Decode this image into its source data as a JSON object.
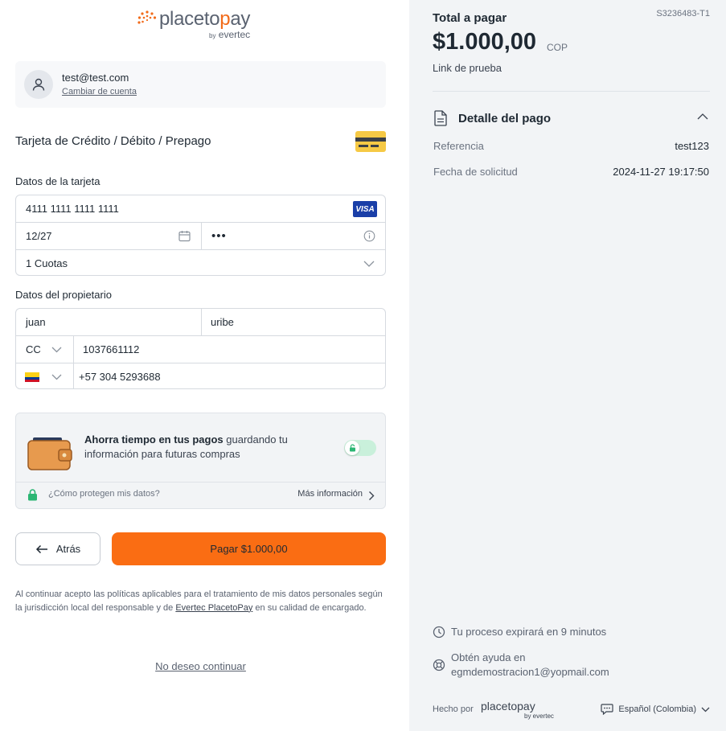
{
  "brand": {
    "name_prefix": "placeto",
    "name_highlight": "p",
    "name_suffix": "ay",
    "by_prefix": "by",
    "by_name": "evertec"
  },
  "account": {
    "email": "test@test.com",
    "change_label": "Cambiar de cuenta"
  },
  "payment_method": {
    "title": "Tarjeta de Crédito / Débito / Prepago"
  },
  "card_section": {
    "label": "Datos de la tarjeta",
    "card_number": "4111 1111 1111 1111",
    "card_brand": "VISA",
    "expiry": "12/27",
    "cvv": "•••",
    "installments": "1 Cuotas"
  },
  "owner_section": {
    "label": "Datos del propietario",
    "first_name": "juan",
    "last_name": "uribe",
    "doc_type": "CC",
    "doc_number": "1037661112",
    "phone": "+57 304 5293688"
  },
  "save_promo": {
    "bold": "Ahorra tiempo en tus pagos",
    "rest": " guardando tu información para futuras compras",
    "toggle_on": false,
    "protect_label": "¿Cómo protegen mis datos?",
    "more_label": "Más información"
  },
  "actions": {
    "back_label": "Atrás",
    "pay_label": "Pagar $1.000,00"
  },
  "legal": {
    "text_before": "Al continuar acepto las políticas aplicables para el tratamiento de mis datos personales según la jurisdicción local del responsable y de ",
    "link": "Evertec PlacetoPay",
    "text_after": " en su calidad de encargado."
  },
  "decline_label": "No deseo continuar",
  "summary": {
    "reference_code": "S3236483-T1",
    "total_label": "Total a pagar",
    "amount": "$1.000,00",
    "currency": "COP",
    "description": "Link de prueba",
    "detail_title": "Detalle del pago",
    "rows": [
      {
        "key": "Referencia",
        "value": "test123"
      },
      {
        "key": "Fecha de solicitud",
        "value": "2024-11-27 19:17:50"
      }
    ],
    "expiry_notice": "Tu proceso expirará en 9 minutos",
    "help_line1": "Obtén ayuda en",
    "help_email": "egmdemostracion1@yopmail.com"
  },
  "footer": {
    "made_by": "Hecho por",
    "brand": "placetopay",
    "brand_by": "by evertec",
    "language": "Español (Colombia)"
  },
  "colors": {
    "accent": "#fa6d13",
    "panel_bg": "#f2f4f6",
    "visa_blue": "#1a3fa8",
    "toggle_green": "#c9f0db",
    "lock_green": "#2bb673"
  }
}
